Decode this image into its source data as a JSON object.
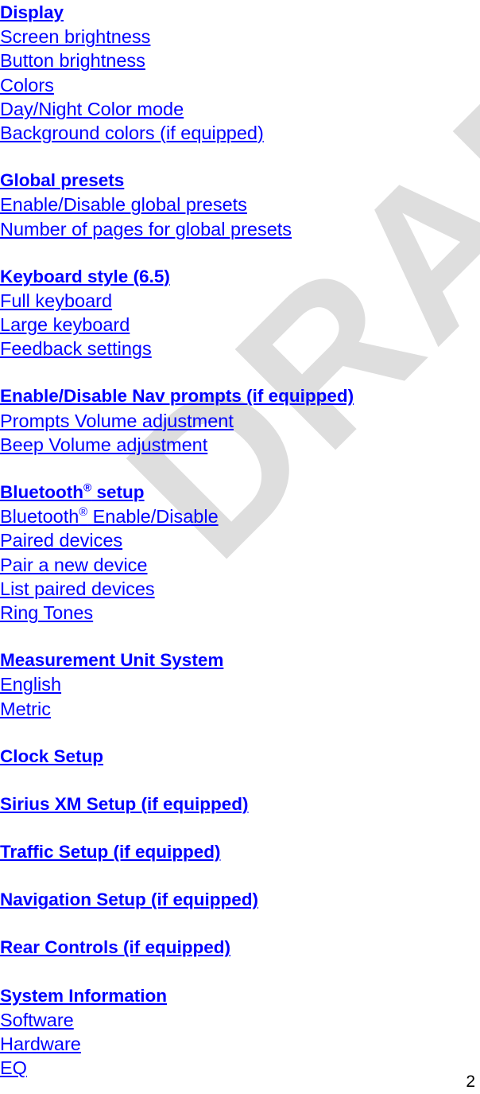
{
  "document": {
    "watermark_text": "DRAFT",
    "watermark_color": "#dedede",
    "link_color": "#0000ff",
    "page_number": "2"
  },
  "toc": {
    "sections": [
      {
        "heading": "Display",
        "items": [
          "Screen brightness",
          "Button brightness",
          "Colors",
          "Day/Night Color mode",
          "Background colors (if equipped)"
        ]
      },
      {
        "heading": "Global presets",
        "items": [
          "Enable/Disable global presets",
          "Number of pages for global presets"
        ]
      },
      {
        "heading": "Keyboard style (6.5)",
        "items": [
          "Full keyboard",
          "Large keyboard",
          "Feedback settings"
        ]
      },
      {
        "heading": "Enable/Disable Nav prompts (if equipped)",
        "items": [
          "Prompts Volume adjustment",
          "Beep Volume adjustment"
        ]
      },
      {
        "heading": "Bluetooth® setup",
        "heading_parts": {
          "base": "Bluetooth",
          "sup": "®",
          "tail": " setup"
        },
        "items": [
          "Bluetooth® Enable/Disable",
          "Paired devices",
          "Pair a new device",
          "List paired devices",
          "Ring Tones"
        ],
        "item_parts": [
          {
            "base": "Bluetooth",
            "sup": "®",
            "tail": " Enable/Disable"
          }
        ]
      },
      {
        "heading": "Measurement Unit System",
        "items": [
          "English",
          "Metric"
        ]
      },
      {
        "heading": "Clock Setup",
        "items": []
      },
      {
        "heading": "Sirius XM Setup (if equipped)",
        "items": []
      },
      {
        "heading": "Traffic Setup (if equipped)",
        "items": []
      },
      {
        "heading": "Navigation Setup (if equipped)",
        "items": []
      },
      {
        "heading": "Rear Controls (if equipped)",
        "items": []
      },
      {
        "heading": "System Information",
        "items": [
          "Software",
          "Hardware",
          "EQ"
        ]
      }
    ]
  }
}
